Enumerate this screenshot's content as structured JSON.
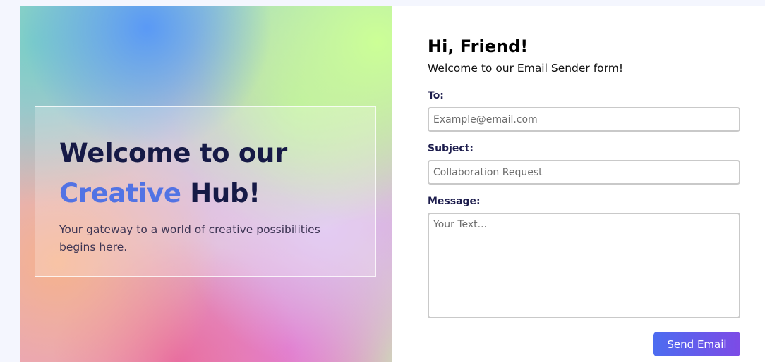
{
  "hero": {
    "title_line1": "Welcome to our",
    "title_accent": "Creative",
    "title_end": " Hub!",
    "subtitle": "Your gateway to a world of creative possibilities begins here."
  },
  "form": {
    "greeting": "Hi, Friend!",
    "welcome": "Welcome to our Email Sender form!",
    "to_label": "To:",
    "to_placeholder": "Example@email.com",
    "subject_label": "Subject:",
    "subject_placeholder": "Collaboration Request",
    "message_label": "Message:",
    "message_placeholder": "Your Text...",
    "send_label": "Send Email"
  },
  "colors": {
    "accent": "#5273e4",
    "button_start": "#4c6cf0",
    "button_end": "#7d4be6",
    "heading": "#161a46"
  }
}
